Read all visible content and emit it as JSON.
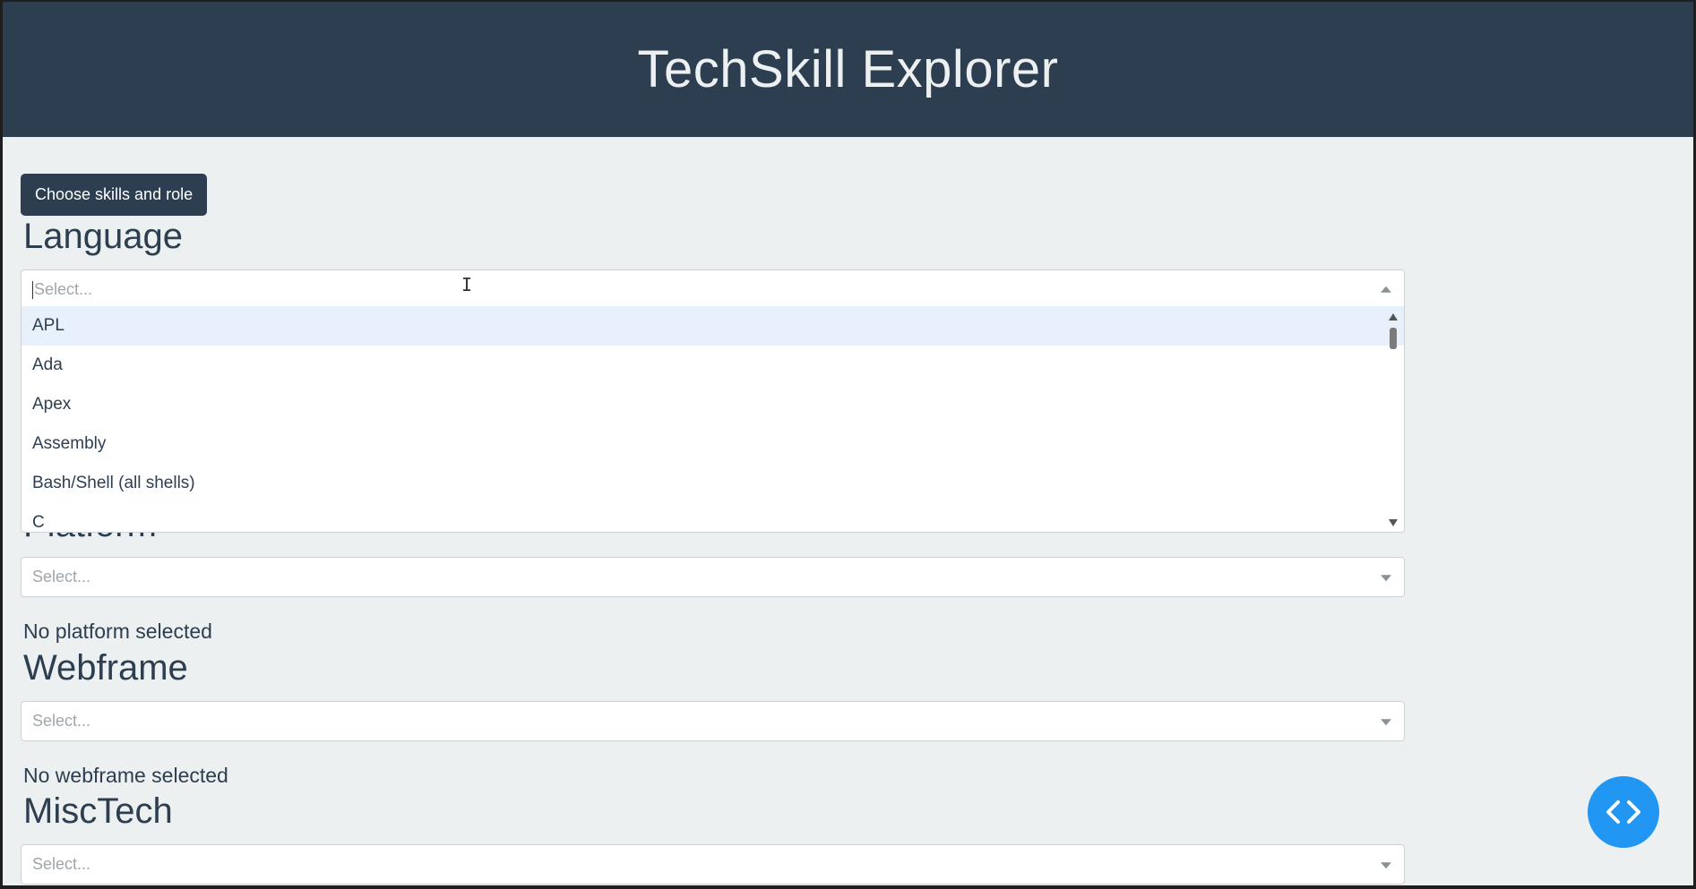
{
  "header": {
    "title": "TechSkill Explorer"
  },
  "toolbar": {
    "choose_label": "Choose skills and role"
  },
  "sections": {
    "language": {
      "title": "Language",
      "placeholder": "Select...",
      "options": [
        "APL",
        "Ada",
        "Apex",
        "Assembly",
        "Bash/Shell (all shells)",
        "C"
      ],
      "highlighted": "APL"
    },
    "platform": {
      "title": "Platform",
      "placeholder": "Select...",
      "status": "No platform selected"
    },
    "webframe": {
      "title": "Webframe",
      "placeholder": "Select...",
      "status": "No webframe selected"
    },
    "misctech": {
      "title": "MiscTech",
      "placeholder": "Select..."
    }
  },
  "colors": {
    "header_bg": "#2c3e50",
    "page_bg": "#ecf0f1",
    "accent": "#2196f3",
    "highlight": "#e8f1fb"
  },
  "icons": {
    "fab": "code-icon",
    "dropdown": "chevron-down-icon"
  }
}
